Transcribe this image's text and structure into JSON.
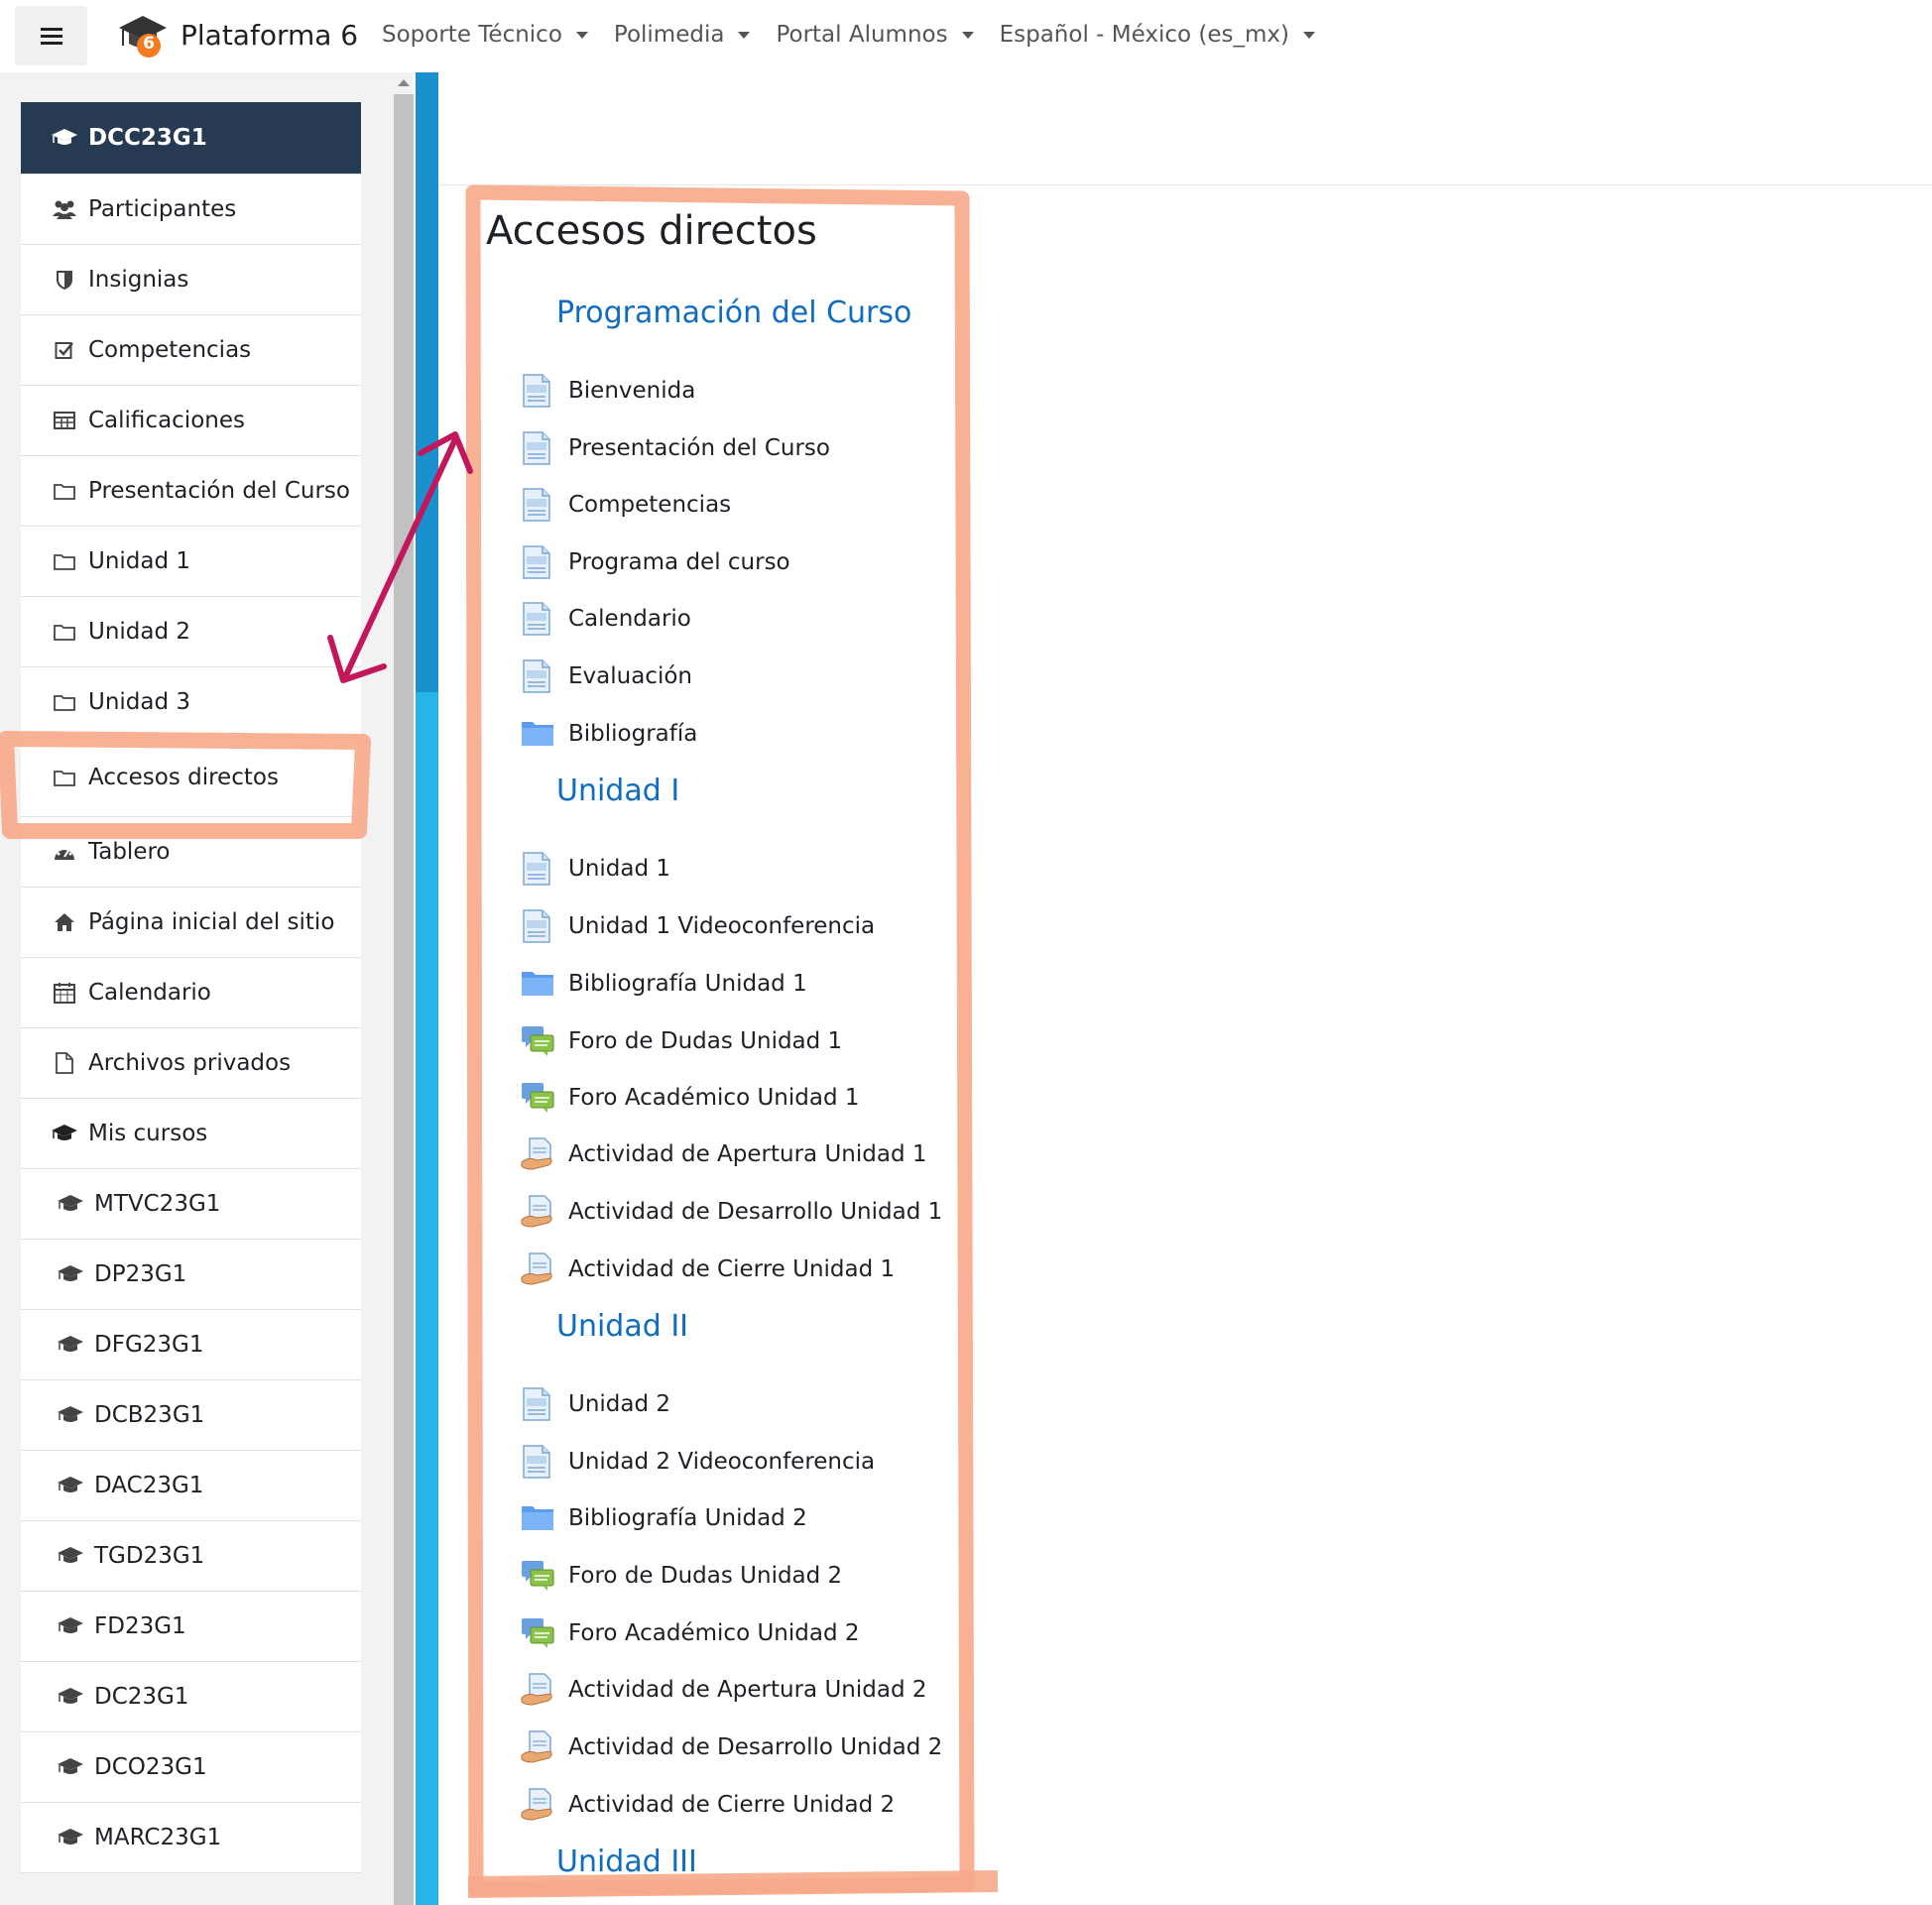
{
  "navbar": {
    "brand_title": "Plataforma 6",
    "brand_badge": "6",
    "links": [
      {
        "label": "Soporte Técnico"
      },
      {
        "label": "Polimedia"
      },
      {
        "label": "Portal Alumnos"
      },
      {
        "label": "Español - México (es_mx)"
      }
    ]
  },
  "sidebar": {
    "course": "DCC23G1",
    "items": [
      {
        "label": "Participantes",
        "icon": "users-icon"
      },
      {
        "label": "Insignias",
        "icon": "shield-icon"
      },
      {
        "label": "Competencias",
        "icon": "checkbox-icon"
      },
      {
        "label": "Calificaciones",
        "icon": "table-icon"
      },
      {
        "label": "Presentación del Curso",
        "icon": "folder-icon"
      },
      {
        "label": "Unidad 1",
        "icon": "folder-icon"
      },
      {
        "label": "Unidad 2",
        "icon": "folder-icon"
      },
      {
        "label": "Unidad 3",
        "icon": "folder-icon"
      },
      {
        "label": "Accesos directos",
        "icon": "folder-icon"
      }
    ],
    "general": [
      {
        "label": "Tablero",
        "icon": "dashboard-icon"
      },
      {
        "label": "Página inicial del sitio",
        "icon": "home-icon"
      },
      {
        "label": "Calendario",
        "icon": "calendar-icon"
      },
      {
        "label": "Archivos privados",
        "icon": "file-icon"
      },
      {
        "label": "Mis cursos",
        "icon": "graduation-cap-icon"
      }
    ],
    "courses": [
      "MTVC23G1",
      "DP23G1",
      "DFG23G1",
      "DCB23G1",
      "DAC23G1",
      "TGD23G1",
      "FD23G1",
      "DC23G1",
      "DCO23G1",
      "MARC23G1"
    ]
  },
  "main": {
    "block_title": "Accesos directos",
    "sections": [
      {
        "title": "Programación del Curso"
      },
      {
        "title": "Unidad I"
      },
      {
        "title": "Unidad II"
      },
      {
        "title": "Unidad III"
      }
    ],
    "activities": [
      {
        "label": "Bienvenida",
        "icon": "page-icon"
      },
      {
        "label": "Presentación del Curso",
        "icon": "page-icon"
      },
      {
        "label": "Competencias",
        "icon": "page-icon"
      },
      {
        "label": "Programa del curso",
        "icon": "page-icon"
      },
      {
        "label": "Calendario",
        "icon": "page-icon"
      },
      {
        "label": "Evaluación",
        "icon": "page-icon"
      },
      {
        "label": "Bibliografía",
        "icon": "folder-blue-icon"
      },
      {
        "label": "Unidad 1",
        "icon": "page-icon"
      },
      {
        "label": "Unidad 1 Videoconferencia",
        "icon": "page-icon"
      },
      {
        "label": "Bibliografía Unidad 1",
        "icon": "folder-blue-icon"
      },
      {
        "label": "Foro de Dudas Unidad 1",
        "icon": "forum-icon"
      },
      {
        "label": "Foro Académico Unidad 1",
        "icon": "forum-icon"
      },
      {
        "label": "Actividad de Apertura Unidad 1",
        "icon": "assignment-icon"
      },
      {
        "label": "Actividad de Desarrollo Unidad 1",
        "icon": "assignment-icon"
      },
      {
        "label": "Actividad de Cierre Unidad 1",
        "icon": "assignment-icon"
      },
      {
        "label": "Unidad 2",
        "icon": "page-icon"
      },
      {
        "label": "Unidad 2 Videoconferencia",
        "icon": "page-icon"
      },
      {
        "label": "Bibliografía Unidad 2",
        "icon": "folder-blue-icon"
      },
      {
        "label": "Foro de Dudas Unidad 2",
        "icon": "forum-icon"
      },
      {
        "label": "Foro Académico Unidad 2",
        "icon": "forum-icon"
      },
      {
        "label": "Actividad de Apertura Unidad 2",
        "icon": "assignment-icon"
      },
      {
        "label": "Actividad de Desarrollo Unidad 2",
        "icon": "assignment-icon"
      },
      {
        "label": "Actividad de Cierre Unidad 2",
        "icon": "assignment-icon"
      }
    ]
  },
  "colors": {
    "accent": "#0f6cbf",
    "sidebar_active": "#263a52",
    "annotation_box": "#f7a98a",
    "annotation_arrow": "#c2185b"
  }
}
